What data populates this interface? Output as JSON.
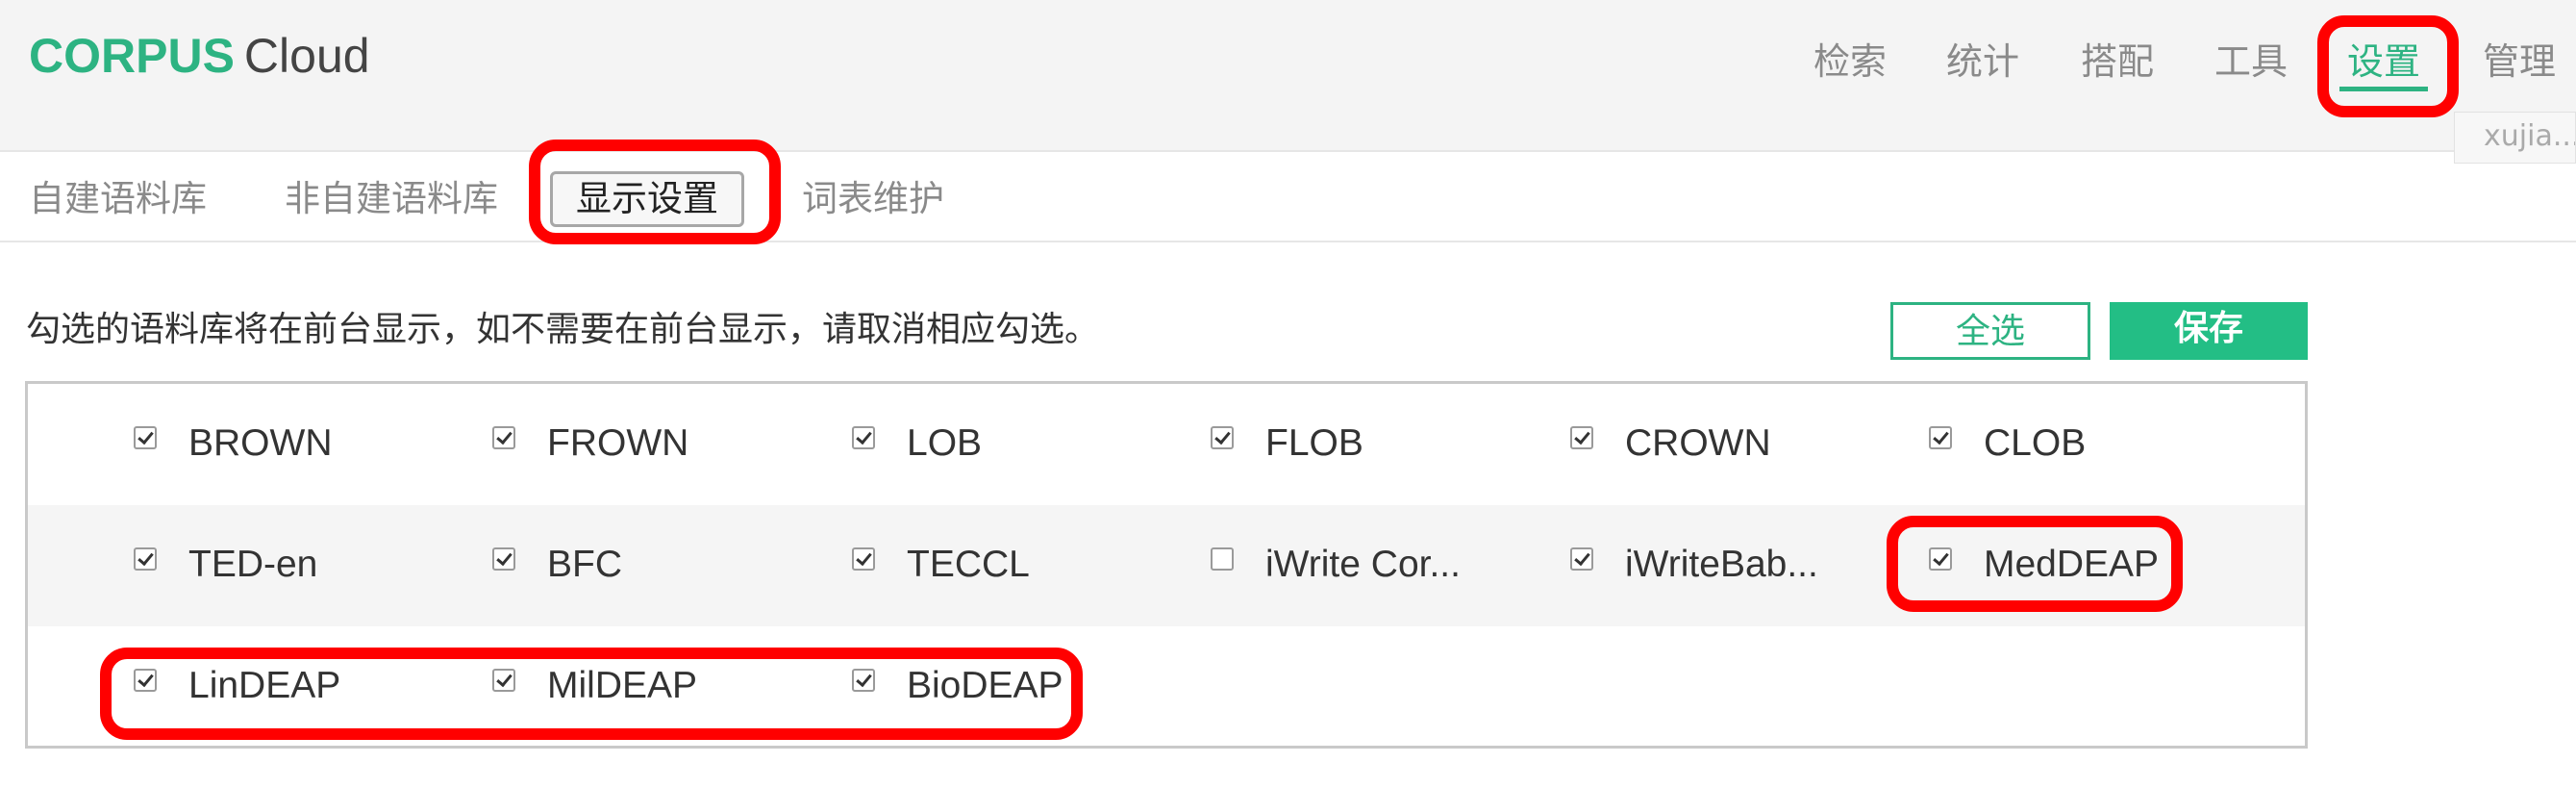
{
  "header": {
    "logo_primary": "CORPUS",
    "logo_secondary": "Cloud",
    "nav": [
      "检索",
      "统计",
      "搭配",
      "工具",
      "设置",
      "管理"
    ],
    "active_nav": "设置",
    "user_name": "xujia..."
  },
  "tabs": [
    "自建语料库",
    "非自建语料库",
    "显示设置",
    "词表维护"
  ],
  "active_tab": "显示设置",
  "instruction": "勾选的语料库将在前台显示，如不需要在前台显示，请取消相应勾选。",
  "buttons": {
    "select_all": "全选",
    "save": "保存"
  },
  "corpora": [
    [
      {
        "label": "BROWN",
        "checked": true
      },
      {
        "label": "FROWN",
        "checked": true
      },
      {
        "label": "LOB",
        "checked": true
      },
      {
        "label": "FLOB",
        "checked": true
      },
      {
        "label": "CROWN",
        "checked": true
      },
      {
        "label": "CLOB",
        "checked": true
      }
    ],
    [
      {
        "label": "TED-en",
        "checked": true
      },
      {
        "label": "BFC",
        "checked": true
      },
      {
        "label": "TECCL",
        "checked": true
      },
      {
        "label": "iWrite Cor...",
        "checked": false
      },
      {
        "label": "iWriteBab...",
        "checked": true
      },
      {
        "label": "MedDEAP",
        "checked": true
      }
    ],
    [
      {
        "label": "LinDEAP",
        "checked": true
      },
      {
        "label": "MilDEAP",
        "checked": true
      },
      {
        "label": "BioDEAP",
        "checked": true
      }
    ]
  ],
  "colors": {
    "brand": "#2db382",
    "save_button": "#23be85",
    "highlight": "#ff0000"
  }
}
